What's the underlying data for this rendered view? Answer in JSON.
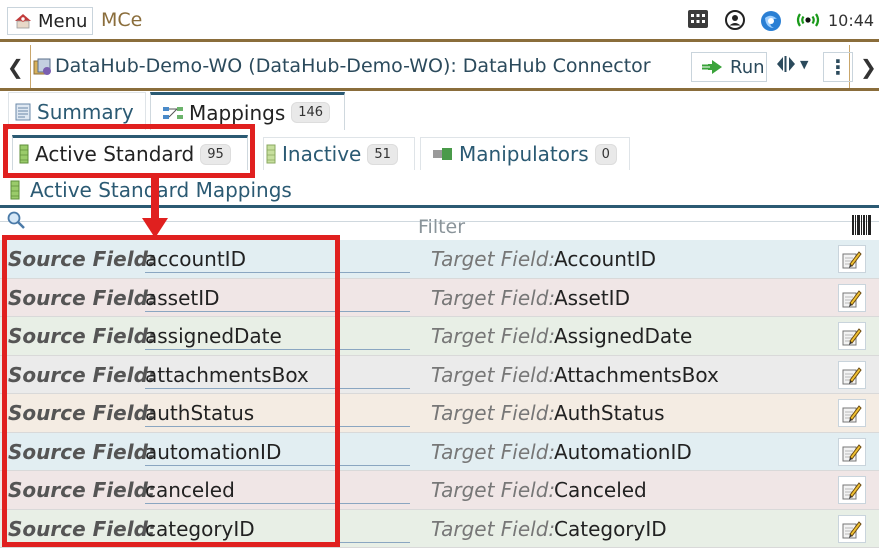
{
  "topbar": {
    "menu_label": "Menu",
    "app_title": "MCe",
    "clock": "10:44",
    "icons": [
      "grid-icon",
      "user-circle-icon",
      "browser-icon",
      "wifi-signal-icon"
    ]
  },
  "breadcrumb": {
    "title": "DataHub-Demo-WO (DataHub-Demo-WO): DataHub Connector",
    "run_label": "Run"
  },
  "tabs_primary": [
    {
      "label": "Summary",
      "badge": ""
    },
    {
      "label": "Mappings",
      "badge": "146"
    }
  ],
  "tabs_secondary": [
    {
      "label": "Active Standard",
      "badge": "95"
    },
    {
      "label": "Inactive",
      "badge": "51"
    },
    {
      "label": "Manipulators",
      "badge": "0"
    }
  ],
  "section_title": "Active Standard Mappings",
  "filter_placeholder": "Filter",
  "labels": {
    "source": "Source Field:",
    "target": "Target Field:"
  },
  "rows": [
    {
      "source": "accountID",
      "target": "AccountID",
      "bg": "#e2eef2"
    },
    {
      "source": "assetID",
      "target": "AssetID",
      "bg": "#f0e6e6"
    },
    {
      "source": "assignedDate",
      "target": "AssignedDate",
      "bg": "#e8efe6"
    },
    {
      "source": "attachmentsBox",
      "target": "AttachmentsBox",
      "bg": "#ebebeb"
    },
    {
      "source": "authStatus",
      "target": "AuthStatus",
      "bg": "#f4ece3"
    },
    {
      "source": "automationID",
      "target": "AutomationID",
      "bg": "#e2eef2"
    },
    {
      "source": "canceled",
      "target": "Canceled",
      "bg": "#f0e6e6"
    },
    {
      "source": "categoryID",
      "target": "CategoryID",
      "bg": "#e8efe6"
    }
  ],
  "colors": {
    "accent": "#2b5a73",
    "brand_brown": "#8a6d3b",
    "annotation_red": "#e0201f"
  }
}
